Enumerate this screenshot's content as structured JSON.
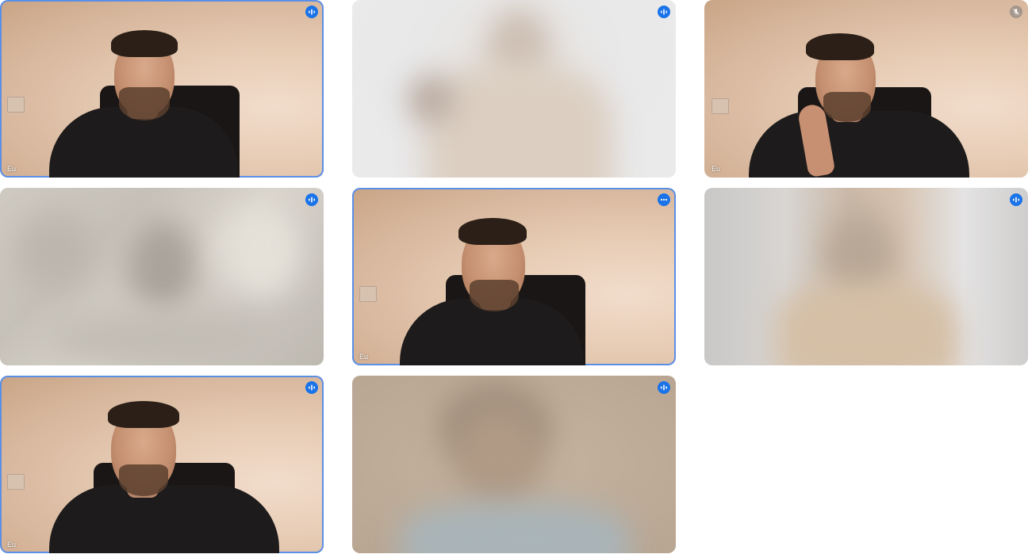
{
  "tiles": [
    {
      "id": "tile-1",
      "name": "Eu",
      "badge": "audio-level-icon",
      "speaking": true,
      "blurred": false
    },
    {
      "id": "tile-2",
      "name": "",
      "badge": "audio-level-icon",
      "speaking": false,
      "blurred": true
    },
    {
      "id": "tile-3",
      "name": "Eu",
      "badge": "mic-off-icon",
      "speaking": false,
      "blurred": false
    },
    {
      "id": "tile-4",
      "name": "",
      "badge": "audio-level-icon",
      "speaking": false,
      "blurred": true
    },
    {
      "id": "tile-5",
      "name": "Eu",
      "badge": "more-options-icon",
      "speaking": true,
      "blurred": false
    },
    {
      "id": "tile-6",
      "name": "",
      "badge": "audio-level-icon",
      "speaking": false,
      "blurred": true
    },
    {
      "id": "tile-7",
      "name": "Eu",
      "badge": "audio-level-icon",
      "speaking": true,
      "blurred": false
    },
    {
      "id": "tile-8",
      "name": "",
      "badge": "audio-level-icon",
      "speaking": false,
      "blurred": true
    }
  ],
  "colors": {
    "badge_active": "#1a73e8",
    "speaking_border": "#5b8fe6",
    "badge_muted": "#8a8a8a"
  }
}
